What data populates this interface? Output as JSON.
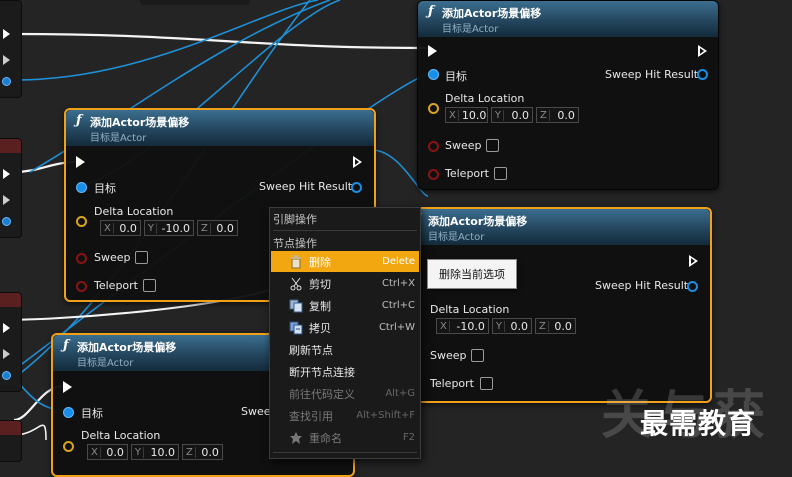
{
  "node_title": "添加Actor场景偏移",
  "node_subtitle": "目标是Actor",
  "labels": {
    "target": "目标",
    "sweep_hit_result": "Sweep Hit Result",
    "delta_location": "Delta Location",
    "sweep": "Sweep",
    "teleport": "Teleport"
  },
  "axes": {
    "x": "X",
    "y": "Y",
    "z": "Z"
  },
  "nodes": [
    {
      "id": "top-right",
      "x_val": "10.0",
      "y_val": "0.0",
      "z_val": "0.0"
    },
    {
      "id": "mid-left",
      "x_val": "0.0",
      "y_val": "-10.0",
      "z_val": "0.0"
    },
    {
      "id": "mid-right",
      "x_val": "-10.0",
      "y_val": "0.0",
      "z_val": "0.0"
    },
    {
      "id": "bottom-left",
      "x_val": "0.0",
      "y_val": "10.0",
      "z_val": "0.0",
      "target_partial": "Swee"
    }
  ],
  "context_menu": {
    "header": "引脚操作",
    "section": "节点操作",
    "items": [
      {
        "label": "删除",
        "shortcut": "Delete",
        "icon": "delete-icon"
      },
      {
        "label": "剪切",
        "shortcut": "Ctrl+X",
        "icon": "cut-icon"
      },
      {
        "label": "复制",
        "shortcut": "Ctrl+C",
        "icon": "copy-icon"
      },
      {
        "label": "拷贝",
        "shortcut": "Ctrl+W",
        "icon": "duplicate-icon"
      },
      {
        "label": "刷新节点",
        "shortcut": ""
      },
      {
        "label": "断开节点连接",
        "shortcut": ""
      },
      {
        "label": "前往代码定义",
        "shortcut": "Alt+G"
      },
      {
        "label": "查找引用",
        "shortcut": "Alt+Shift+F"
      },
      {
        "label": "重命名",
        "shortcut": "F2",
        "icon": "rename-icon"
      }
    ]
  },
  "tooltip": "删除当前选项",
  "watermark": {
    "big": "关与获",
    "brand": "最需教育"
  },
  "colors": {
    "selection": "#f0a11a",
    "highlight": "#f2a711",
    "wire": "#1f8fd6",
    "exec": "#ffffff"
  }
}
